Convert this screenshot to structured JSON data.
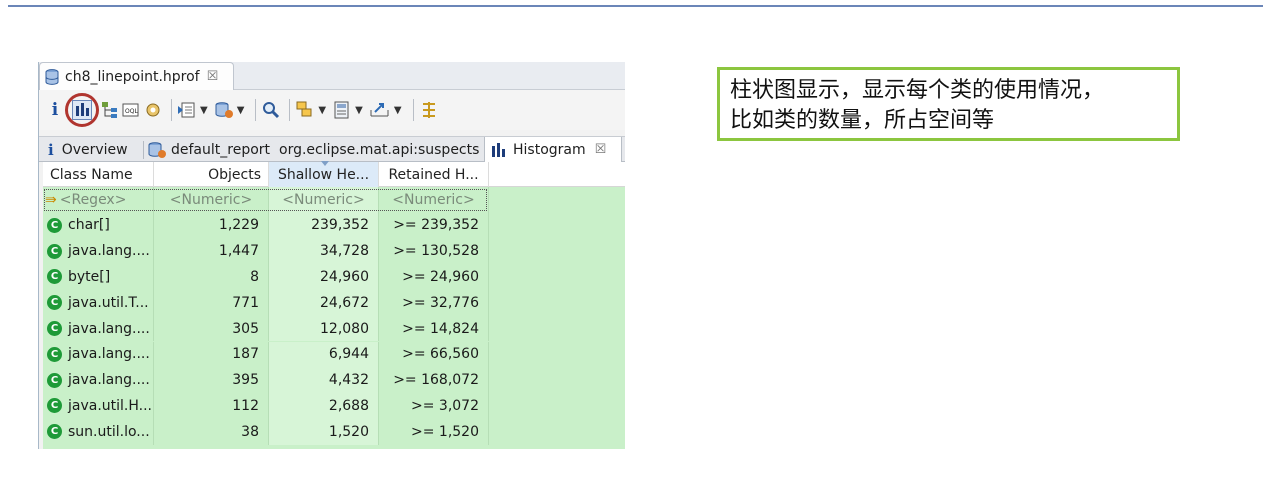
{
  "editor_tab": {
    "title": "ch8_linepoint.hprof",
    "close": "☒"
  },
  "toolbar": {
    "info": "i",
    "icons": [
      "histogram-icon",
      "dominator-tree-icon",
      "oql-icon",
      "heap-dump-details-icon",
      "run-report-icon",
      "query-browser-icon",
      "find-object-icon",
      "group-icon",
      "calculator-icon",
      "export-icon",
      "pin-icon"
    ]
  },
  "view_tabs": [
    {
      "label": "Overview"
    },
    {
      "label": "default_report"
    },
    {
      "label": "org.eclipse.mat.api:suspects"
    },
    {
      "label": "Histogram",
      "close": "☒"
    }
  ],
  "table": {
    "columns": [
      "Class Name",
      "Objects",
      "Shallow He...",
      "Retained H..."
    ],
    "sorted_column": "Shallow He...",
    "filter": [
      "<Regex>",
      "<Numeric>",
      "<Numeric>",
      "<Numeric>"
    ],
    "rows": [
      {
        "name": "char[]",
        "objects": "1,229",
        "shallow": "239,352",
        "retained": ">= 239,352"
      },
      {
        "name": "java.lang....",
        "objects": "1,447",
        "shallow": "34,728",
        "retained": ">= 130,528"
      },
      {
        "name": "byte[]",
        "objects": "8",
        "shallow": "24,960",
        "retained": ">= 24,960"
      },
      {
        "name": "java.util.T...",
        "objects": "771",
        "shallow": "24,672",
        "retained": ">= 32,776"
      },
      {
        "name": "java.lang....",
        "objects": "305",
        "shallow": "12,080",
        "retained": ">= 14,824"
      },
      {
        "name": "java.lang....",
        "objects": "187",
        "shallow": "6,944",
        "retained": ">= 66,560"
      },
      {
        "name": "java.lang....",
        "objects": "395",
        "shallow": "4,432",
        "retained": ">= 168,072"
      },
      {
        "name": "java.util.H...",
        "objects": "112",
        "shallow": "2,688",
        "retained": ">= 3,072"
      },
      {
        "name": "sun.util.lo...",
        "objects": "38",
        "shallow": "1,520",
        "retained": ">= 1,520"
      }
    ]
  },
  "annotation": {
    "line1": "柱状图显示，显示每个类的使用情况，",
    "line2": "比如类的数量，所占空间等"
  },
  "colors": {
    "highlight_circle": "#b0352f",
    "annotation_border": "#8cc63f",
    "row_bg": "#c9f0c9"
  }
}
